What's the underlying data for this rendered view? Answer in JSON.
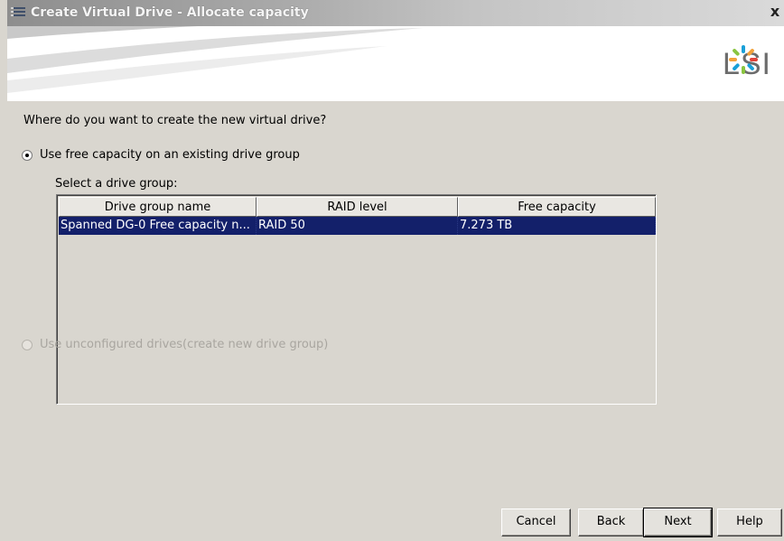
{
  "window": {
    "title": "Create Virtual Drive - Allocate capacity",
    "close_label": "x"
  },
  "banner": {
    "logo_text": "LSI"
  },
  "main": {
    "question": "Where do you want to create the new virtual drive?",
    "option_existing": {
      "label": "Use free capacity on an existing drive group",
      "selected": true
    },
    "select_label": "Select a drive group:",
    "table": {
      "columns": [
        "Drive group name",
        "RAID level",
        "Free capacity"
      ],
      "rows": [
        {
          "name": "Spanned DG-0 Free capacity n...",
          "raid": "RAID 50",
          "free": "7.273 TB",
          "selected": true
        }
      ]
    },
    "option_new": {
      "label": "Use unconfigured drives(create new drive group)",
      "selected": false,
      "enabled": false
    }
  },
  "buttons": {
    "cancel": "Cancel",
    "back": "Back",
    "next": "Next",
    "help": "Help"
  },
  "colors": {
    "selection": "#13206a",
    "dialog_bg": "#d9d6cf",
    "logo_accents": [
      "#1aa0d8",
      "#f2a23a",
      "#8ac540",
      "#e0443a"
    ]
  }
}
